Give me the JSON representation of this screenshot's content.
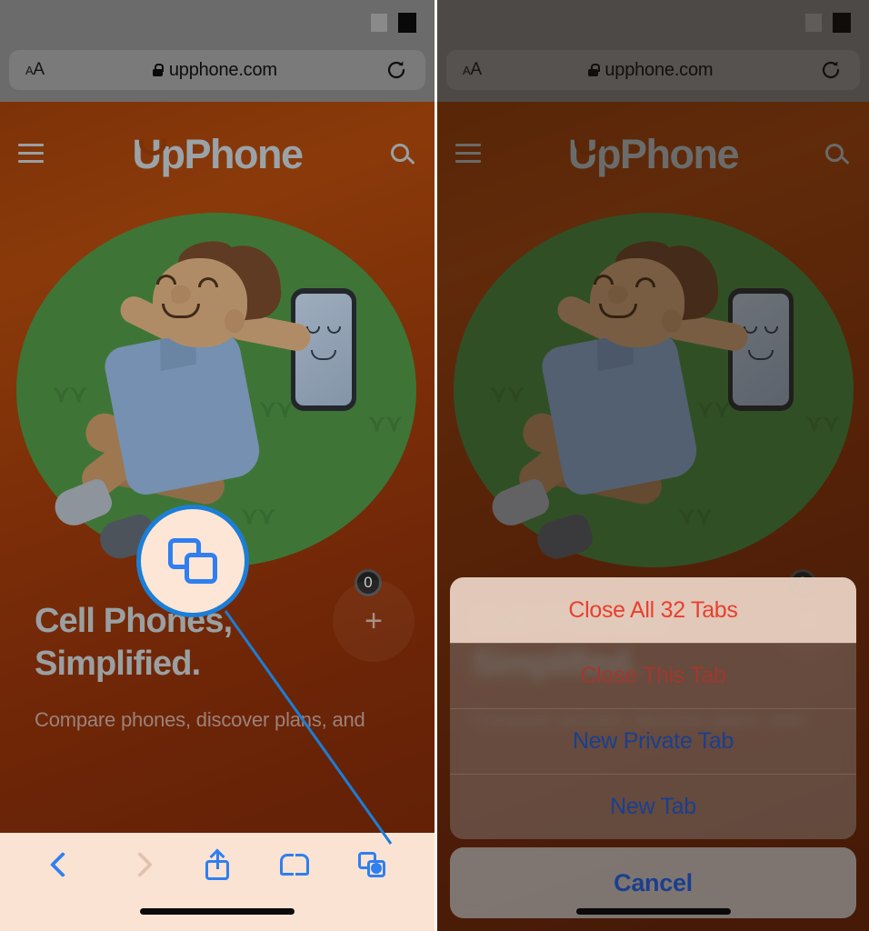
{
  "browser": {
    "address_bar": {
      "text_size_label_small": "A",
      "text_size_label_large": "A",
      "url": "upphone.com",
      "lock_icon": "lock-icon",
      "reload_icon": "reload-icon"
    },
    "status_icons": [
      "grey-square-indicator",
      "black-square-indicator"
    ],
    "toolbar": {
      "back": "back-chevron-icon",
      "forward": "forward-chevron-icon",
      "share": "share-icon",
      "bookmarks": "bookmarks-icon",
      "tabs": "tabs-icon"
    }
  },
  "site": {
    "menu_icon": "hamburger-menu-icon",
    "logo_first": "U",
    "logo_rest": "pPhone",
    "search_icon": "search-icon",
    "headline_line1": "Cell Phones,",
    "headline_line2": "Simplified.",
    "subtext": "Compare phones, discover plans, and",
    "badge_count": "0",
    "fab_label": "+"
  },
  "illustration": {
    "name": "person-sleeping-on-grass-with-phone",
    "grass_color": "#3e7536",
    "background_color": "#7d3208"
  },
  "annotation": {
    "callout_icon": "tabs-icon",
    "accent_color": "#1c7ed6"
  },
  "action_sheet": {
    "items": [
      {
        "label": "Close All 32 Tabs",
        "style": "destructive",
        "highlighted": true
      },
      {
        "label": "Close This Tab",
        "style": "destructive",
        "highlighted": false
      },
      {
        "label": "New Private Tab",
        "style": "default",
        "highlighted": false
      },
      {
        "label": "New Tab",
        "style": "default",
        "highlighted": false
      }
    ],
    "cancel_label": "Cancel",
    "destructive_color": "#e8402f",
    "default_color": "#1a3f8f"
  }
}
